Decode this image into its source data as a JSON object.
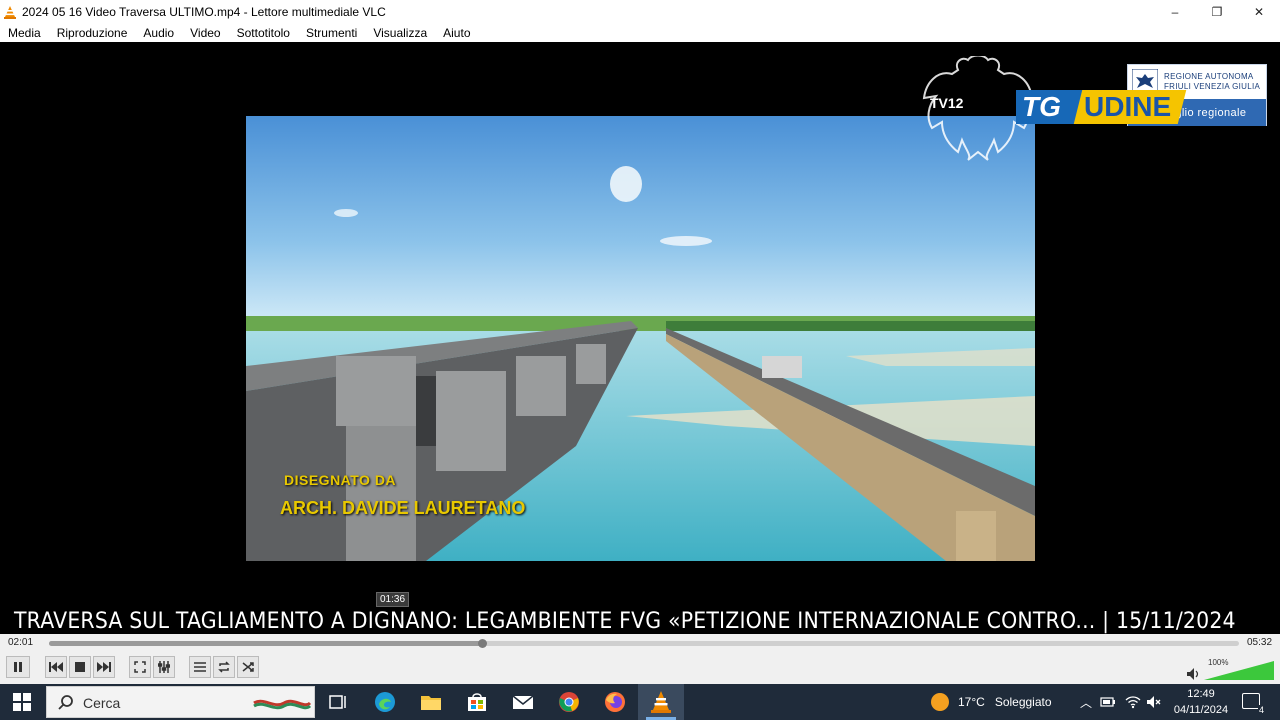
{
  "window": {
    "title": "2024 05 16 Video Traversa ULTIMO.mp4 - Lettore multimediale VLC",
    "minimize": "–",
    "restore": "❐",
    "close": "✕"
  },
  "menu": [
    "Media",
    "Riproduzione",
    "Audio",
    "Video",
    "Sottotitolo",
    "Strumenti",
    "Visualizza",
    "Aiuto"
  ],
  "overlay": {
    "regione_line1": "REGIONE AUTONOMA",
    "regione_line2": "FRIULI VENEZIA GIULIA",
    "consiglio": "consiglio regionale",
    "tv12": "TV12",
    "tg": "TG",
    "udine": "UDINE",
    "credit_line1": "DISEGNATO DA",
    "credit_line2": "ARCH. DAVIDE LAURETANO",
    "headline": "TRAVERSA SUL TAGLIAMENTO A DIGNANO: LEGAMBIENTE FVG «PETIZIONE INTERNAZIONALE CONTRO... | 15/11/2024",
    "hover_time": "01:36"
  },
  "player": {
    "elapsed": "02:01",
    "total": "05:32",
    "progress_fraction": 0.364,
    "volume": "100%",
    "volume_fraction": 1.0
  },
  "taskbar": {
    "search_placeholder": "Cerca",
    "temperature": "17°C",
    "weather": "Soleggiato",
    "time": "12:49",
    "date": "04/11/2024",
    "notifications": "4"
  },
  "colors": {
    "accent_tg": "#1768b7",
    "accent_udine": "#f5c400",
    "credit_text": "#e8c800",
    "regione_blue": "#2f69b3"
  }
}
